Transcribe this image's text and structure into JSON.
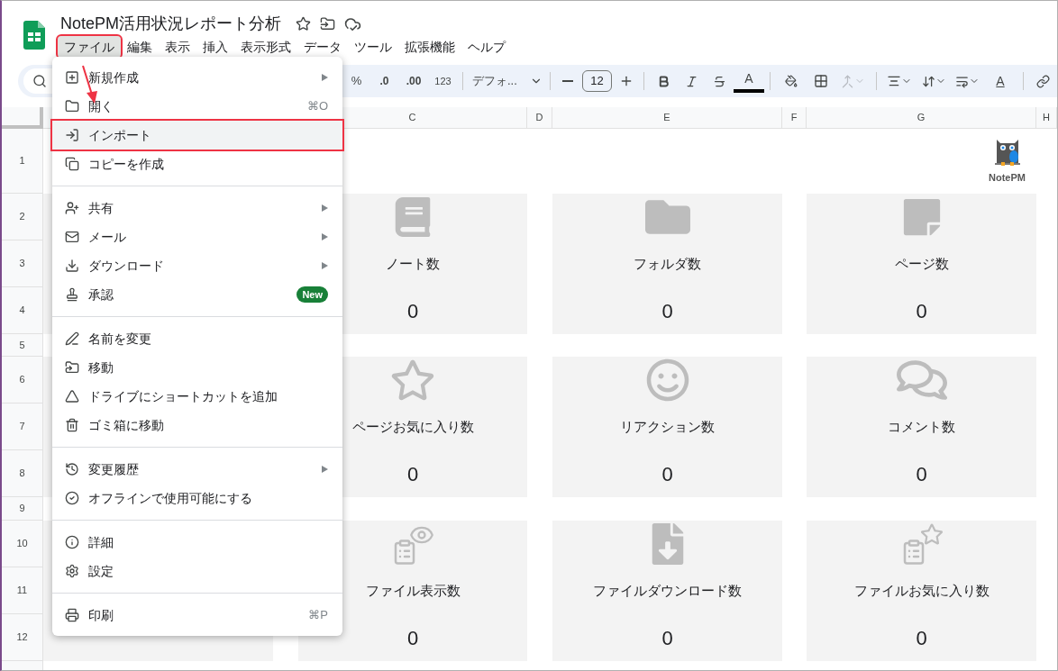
{
  "document": {
    "title": "NotePM活用状況レポート分析"
  },
  "menubar": [
    {
      "label": "ファイル",
      "selected": true,
      "callout": true
    },
    {
      "label": "編集",
      "selected": false,
      "callout": false
    },
    {
      "label": "表示",
      "selected": false,
      "callout": false
    },
    {
      "label": "挿入",
      "selected": false,
      "callout": false
    },
    {
      "label": "表示形式",
      "selected": false,
      "callout": false
    },
    {
      "label": "データ",
      "selected": false,
      "callout": false
    },
    {
      "label": "ツール",
      "selected": false,
      "callout": false
    },
    {
      "label": "拡張機能",
      "selected": false,
      "callout": false
    },
    {
      "label": "ヘルプ",
      "selected": false,
      "callout": false
    }
  ],
  "toolbar": {
    "percent": "%",
    "decrease_decimals": ".0",
    "increase_decimals": ".00",
    "number_format": "123",
    "font": "デフォ...",
    "font_size": "12",
    "text_color_glyph": "A",
    "rotation_glyph": "A",
    "merge_disabled": true
  },
  "columns": [
    "C",
    "D",
    "E",
    "F",
    "G",
    "H"
  ],
  "rows": [
    "1",
    "2",
    "3",
    "4",
    "5",
    "6",
    "7",
    "8",
    "9",
    "10",
    "11",
    "12"
  ],
  "logo": {
    "text": "NotePM"
  },
  "cards": [
    [
      {
        "kind": "covered"
      },
      {
        "kind": "book",
        "label": "ノート数",
        "value": "0"
      },
      {
        "kind": "folder",
        "label": "フォルダ数",
        "value": "0"
      },
      {
        "kind": "page",
        "label": "ページ数",
        "value": "0"
      }
    ],
    [
      {
        "kind": "covered"
      },
      {
        "kind": "star",
        "label": "ページお気に入り数",
        "value": "0"
      },
      {
        "kind": "smile",
        "label": "リアクション数",
        "value": "0"
      },
      {
        "kind": "comments",
        "label": "コメント数",
        "value": "0"
      }
    ],
    [
      {
        "kind": "covered"
      },
      {
        "kind": "file-view",
        "label": "ファイル表示数",
        "value": "0"
      },
      {
        "kind": "file-download",
        "label": "ファイルダウンロード数",
        "value": "0"
      },
      {
        "kind": "file-star",
        "label": "ファイルお気に入り数",
        "value": "0"
      }
    ]
  ],
  "file_menu": [
    [
      {
        "label": "新規作成",
        "submenu": true,
        "highlighted": false,
        "callout": false
      },
      {
        "label": "開く",
        "shortcut": "⌘O",
        "submenu": false,
        "highlighted": false,
        "callout": false
      },
      {
        "label": "インポート",
        "submenu": false,
        "highlighted": true,
        "callout": true
      },
      {
        "label": "コピーを作成",
        "submenu": false,
        "highlighted": false,
        "callout": false
      }
    ],
    [
      {
        "label": "共有",
        "submenu": true,
        "highlighted": false,
        "callout": false
      },
      {
        "label": "メール",
        "submenu": true,
        "highlighted": false,
        "callout": false
      },
      {
        "label": "ダウンロード",
        "submenu": true,
        "highlighted": false,
        "callout": false
      },
      {
        "label": "承認",
        "badge": "New",
        "submenu": false,
        "highlighted": false,
        "callout": false
      }
    ],
    [
      {
        "label": "名前を変更",
        "submenu": false,
        "highlighted": false,
        "callout": false
      },
      {
        "label": "移動",
        "submenu": false,
        "highlighted": false,
        "callout": false
      },
      {
        "label": "ドライブにショートカットを追加",
        "submenu": false,
        "highlighted": false,
        "callout": false
      },
      {
        "label": "ゴミ箱に移動",
        "submenu": false,
        "highlighted": false,
        "callout": false
      }
    ],
    [
      {
        "label": "変更履歴",
        "submenu": true,
        "highlighted": false,
        "callout": false
      },
      {
        "label": "オフラインで使用可能にする",
        "submenu": false,
        "highlighted": false,
        "callout": false
      }
    ],
    [
      {
        "label": "詳細",
        "submenu": false,
        "highlighted": false,
        "callout": false
      },
      {
        "label": "設定",
        "submenu": false,
        "highlighted": false,
        "callout": false
      }
    ],
    [
      {
        "label": "印刷",
        "shortcut": "⌘P",
        "submenu": false,
        "highlighted": false,
        "callout": false
      }
    ]
  ]
}
